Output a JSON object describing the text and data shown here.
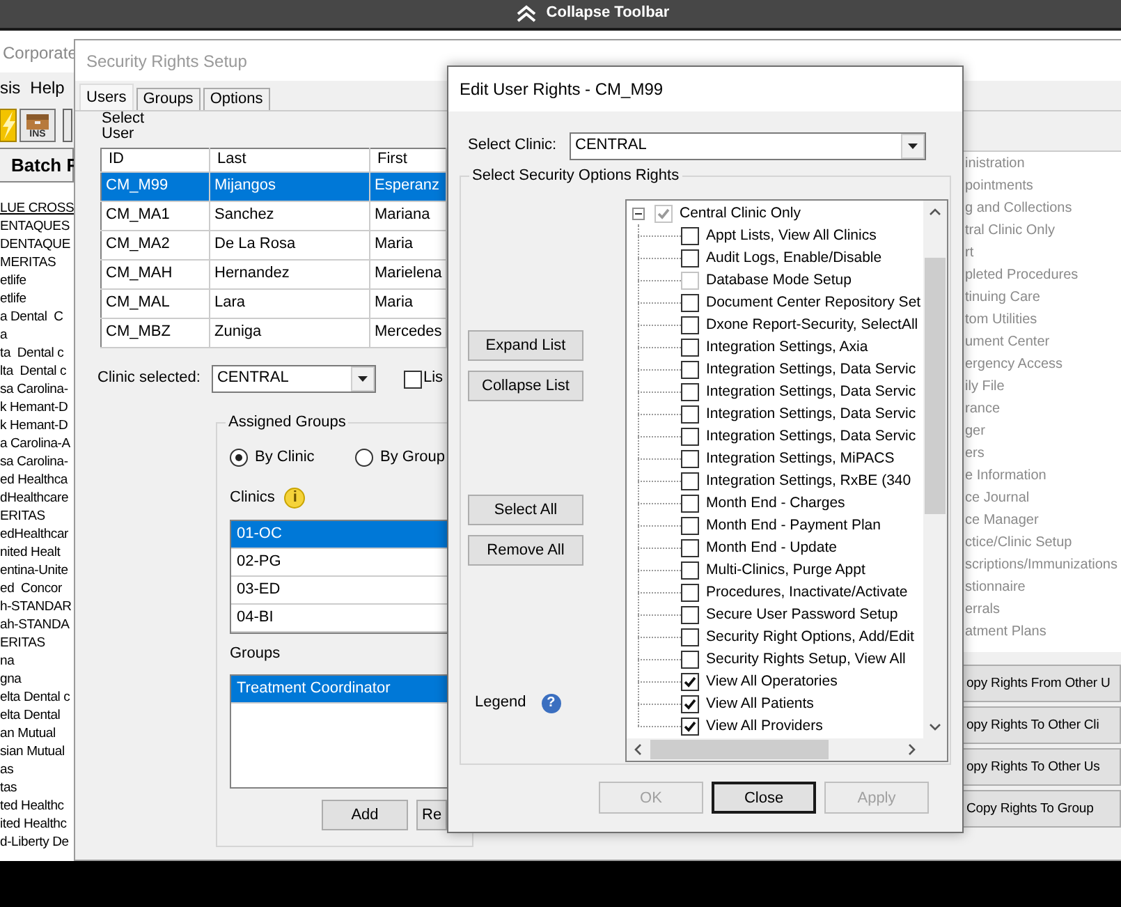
{
  "top_bar": {
    "label": "Collapse Toolbar"
  },
  "background_window": {
    "title": "Corporate",
    "menu": [
      "sis",
      "Help"
    ],
    "toolbar_label": "INS",
    "header": "Batch F",
    "items": [
      {
        "label": "LUE CROSS",
        "hovered": true
      },
      {
        "label": "ENTAQUES",
        "hovered": false
      },
      {
        "label": "DENTAQUE",
        "hovered": false
      },
      {
        "label": "MERITAS",
        "hovered": false
      },
      {
        "label": "etlife",
        "hovered": false
      },
      {
        "label": "etlife",
        "hovered": false
      },
      {
        "label": "a Dental  C",
        "hovered": false
      },
      {
        "label": "a",
        "hovered": false
      },
      {
        "label": "ta  Dental c",
        "hovered": false
      },
      {
        "label": "lta  Dental c",
        "hovered": false
      },
      {
        "label": "sa Carolina-",
        "hovered": false
      },
      {
        "label": "k Hemant-D",
        "hovered": false
      },
      {
        "label": "k Hemant-D",
        "hovered": false
      },
      {
        "label": "a Carolina-A",
        "hovered": false
      },
      {
        "label": "sa Carolina-",
        "hovered": false
      },
      {
        "label": "ed Healthca",
        "hovered": false
      },
      {
        "label": "dHealthcare",
        "hovered": false
      },
      {
        "label": "ERITAS",
        "hovered": false
      },
      {
        "label": "edHealthcar",
        "hovered": false
      },
      {
        "label": "nited Healt",
        "hovered": false
      },
      {
        "label": "entina-Unite",
        "hovered": false
      },
      {
        "label": "ed  Concor",
        "hovered": false
      },
      {
        "label": "h-STANDAR",
        "hovered": false
      },
      {
        "label": "ah-STANDA",
        "hovered": false
      },
      {
        "label": "ERITAS",
        "hovered": false
      },
      {
        "label": "na",
        "hovered": false
      },
      {
        "label": "gna",
        "hovered": false
      },
      {
        "label": "elta Dental c",
        "hovered": false
      },
      {
        "label": "elta Dental",
        "hovered": false
      },
      {
        "label": "an Mutual",
        "hovered": false
      },
      {
        "label": "sian Mutual",
        "hovered": false
      },
      {
        "label": "as",
        "hovered": false
      },
      {
        "label": "tas",
        "hovered": false
      },
      {
        "label": "ted Healthc",
        "hovered": false
      },
      {
        "label": "ited Healthc",
        "hovered": false
      },
      {
        "label": "d-Liberty De",
        "hovered": false
      }
    ]
  },
  "security_window": {
    "title": "Security Rights Setup",
    "tabs": [
      {
        "label": "Users",
        "selected": true
      },
      {
        "label": "Groups",
        "selected": false
      },
      {
        "label": "Options",
        "selected": false
      }
    ],
    "select_user_label": "Select User",
    "users_table": {
      "columns": [
        "ID",
        "Last",
        "First"
      ],
      "rows": [
        {
          "cells": [
            "CM_M99",
            "Mijangos",
            "Esperanz"
          ],
          "selected": true
        },
        {
          "cells": [
            "CM_MA1",
            "Sanchez",
            "Mariana"
          ],
          "selected": false
        },
        {
          "cells": [
            "CM_MA2",
            "De La Rosa",
            "Maria"
          ],
          "selected": false
        },
        {
          "cells": [
            "CM_MAH",
            "Hernandez",
            "Marielena"
          ],
          "selected": false
        },
        {
          "cells": [
            "CM_MAL",
            "Lara",
            "Maria"
          ],
          "selected": false
        },
        {
          "cells": [
            "CM_MBZ",
            "Zuniga",
            "Mercedes"
          ],
          "selected": false
        }
      ]
    },
    "clinic_selected": {
      "label": "Clinic selected:",
      "value": "CENTRAL"
    },
    "list_option": {
      "label": "Lis",
      "checked": false
    },
    "assigned_groups": {
      "title": "Assigned Groups",
      "modes": [
        {
          "label": "By Clinic",
          "selected": true
        },
        {
          "label": "By Group",
          "selected": false
        }
      ],
      "clinics_label": "Clinics",
      "info_icon": "i",
      "clinics": [
        {
          "label": "01-OC",
          "selected": true
        },
        {
          "label": "02-PG",
          "selected": false
        },
        {
          "label": "03-ED",
          "selected": false
        },
        {
          "label": "04-BI",
          "selected": false
        }
      ],
      "groups_label": "Groups",
      "groups": [
        {
          "label": "Treatment Coordinator",
          "selected": true
        }
      ],
      "buttons": [
        "Add",
        "Re"
      ]
    },
    "categories": [
      "inistration",
      "pointments",
      "g and Collections",
      "tral Clinic Only",
      "rt",
      "pleted Procedures",
      "tinuing Care",
      "tom Utilities",
      "ument Center",
      "ergency Access",
      "ily File",
      "rance",
      "ger",
      "ers",
      "e Information",
      "ce Journal",
      "ce Manager",
      "ctice/Clinic Setup",
      "scriptions/Immunizations",
      "stionnaire",
      "errals",
      "atment Plans"
    ],
    "copy_buttons": [
      "opy Rights From Other U",
      "opy Rights To Other Cli",
      "opy Rights To Other Us",
      "Copy Rights To Group"
    ]
  },
  "edit_dialog": {
    "title": "Edit User Rights - CM_M99",
    "clinic": {
      "label": "Select Clinic:",
      "value": "CENTRAL"
    },
    "group_title": "Select Security Options Rights",
    "list_buttons": [
      "Expand List",
      "Collapse List"
    ],
    "selection_buttons": [
      "Select All",
      "Remove All"
    ],
    "legend_label": "Legend",
    "help_icon": "?",
    "tree": [
      {
        "label": "Central Clinic Only",
        "expanded": true,
        "checked": true,
        "disabled": true,
        "children": [
          {
            "label": "Appt Lists, View All Clinics",
            "checked": false,
            "disabled": false
          },
          {
            "label": "Audit Logs, Enable/Disable",
            "checked": false,
            "disabled": false
          },
          {
            "label": "Database Mode Setup",
            "checked": false,
            "disabled": true
          },
          {
            "label": "Document Center Repository Set",
            "checked": false,
            "disabled": false
          },
          {
            "label": "Dxone Report-Security, SelectAll",
            "checked": false,
            "disabled": false
          },
          {
            "label": "Integration Settings, Axia",
            "checked": false,
            "disabled": false
          },
          {
            "label": "Integration Settings, Data Servic",
            "checked": false,
            "disabled": false
          },
          {
            "label": "Integration Settings, Data Servic",
            "checked": false,
            "disabled": false
          },
          {
            "label": "Integration Settings, Data Servic",
            "checked": false,
            "disabled": false
          },
          {
            "label": "Integration Settings, Data Servic",
            "checked": false,
            "disabled": false
          },
          {
            "label": "Integration Settings, MiPACS",
            "checked": false,
            "disabled": false
          },
          {
            "label": "Integration Settings, RxBE (340",
            "checked": false,
            "disabled": false
          },
          {
            "label": "Month End - Charges",
            "checked": false,
            "disabled": false
          },
          {
            "label": "Month End - Payment Plan",
            "checked": false,
            "disabled": false
          },
          {
            "label": "Month End - Update",
            "checked": false,
            "disabled": false
          },
          {
            "label": "Multi-Clinics, Purge Appt",
            "checked": false,
            "disabled": false
          },
          {
            "label": "Procedures, Inactivate/Activate",
            "checked": false,
            "disabled": false
          },
          {
            "label": "Secure User Password Setup",
            "checked": false,
            "disabled": false
          },
          {
            "label": "Security Right Options, Add/Edit",
            "checked": false,
            "disabled": false
          },
          {
            "label": "Security Rights Setup, View All",
            "checked": false,
            "disabled": false
          },
          {
            "label": "View All Operatories",
            "checked": true,
            "disabled": false
          },
          {
            "label": "View All Patients",
            "checked": true,
            "disabled": false
          },
          {
            "label": "View All Providers",
            "checked": true,
            "disabled": false
          }
        ]
      }
    ],
    "footer_buttons": [
      {
        "label": "OK",
        "disabled": true,
        "default": false
      },
      {
        "label": "Close",
        "disabled": false,
        "default": true
      },
      {
        "label": "Apply",
        "disabled": true,
        "default": false
      }
    ]
  }
}
